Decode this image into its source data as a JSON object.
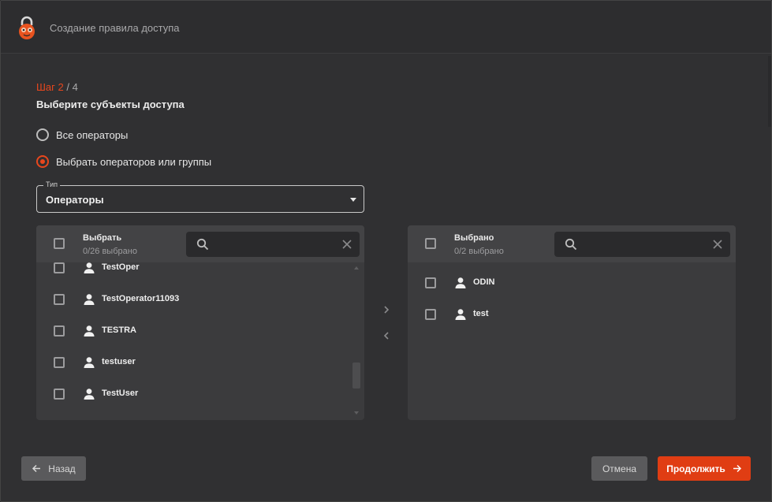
{
  "window": {
    "title": "Создание правила доступа"
  },
  "step": {
    "current": "Шаг 2",
    "separator": " / ",
    "total": "4"
  },
  "subtitle": "Выберите субъекты доступа",
  "options": {
    "all_operators": "Все операторы",
    "select_operators": "Выбрать операторов или группы",
    "selected": "select_operators"
  },
  "type_select": {
    "legend": "Тип",
    "value": "Операторы"
  },
  "left_panel": {
    "title": "Выбрать",
    "count": "0/26 выбрано",
    "search_value": "",
    "items": [
      {
        "name": "TestOper"
      },
      {
        "name": "TestOperator11093"
      },
      {
        "name": "TESTRA"
      },
      {
        "name": "testuser"
      },
      {
        "name": "TestUser"
      },
      {
        "name": ""
      }
    ]
  },
  "right_panel": {
    "title": "Выбрано",
    "count": "0/2 выбрано",
    "search_value": "",
    "items": [
      {
        "name": "ODIN"
      },
      {
        "name": "test"
      }
    ]
  },
  "buttons": {
    "back": "Назад",
    "cancel": "Отмена",
    "continue": "Продолжить"
  },
  "colors": {
    "accent": "#e8471d",
    "background": "#303032",
    "panel": "#3b3b3d"
  }
}
